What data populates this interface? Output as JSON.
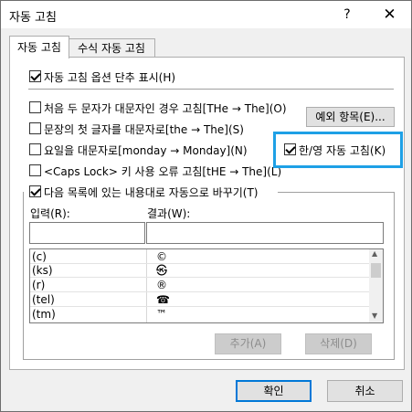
{
  "window": {
    "title": "자동 고침",
    "help": "?",
    "close": "✕"
  },
  "tabs": [
    {
      "label": "자동 고침"
    },
    {
      "label": "수식 자동 고침"
    }
  ],
  "options": {
    "show_button": "자동 고침 옵션 단추 표시(H)",
    "two_caps": "처음 두 문자가 대문자인 경우 고침[THe → The](O)",
    "first_letter": "문장의 첫 글자를 대문자로[the → The](S)",
    "days": "요일을 대문자로[monday → Monday](N)",
    "caps_lock": "<Caps Lock> 키 사용 오류 고침[tHE → The](L)",
    "hangul_eng": "한/영 자동 고침(K)",
    "replace_as_type": "다음 목록에 있는 내용대로 자동으로 바꾸기(T)"
  },
  "exceptions_button": "예외 항목(E)...",
  "replace_label": "입력(R):",
  "with_label": "결과(W):",
  "replace_value": "",
  "with_value": "",
  "entries": [
    {
      "input": "(c)",
      "result": "©"
    },
    {
      "input": "(ks)",
      "result": "㉿"
    },
    {
      "input": "(r)",
      "result": "®"
    },
    {
      "input": "(tel)",
      "result": "☎"
    },
    {
      "input": "(tm)",
      "result": "™"
    }
  ],
  "add_button": "추가(A)",
  "delete_button": "삭제(D)",
  "ok_button": "확인",
  "cancel_button": "취소",
  "scroll_up": "▲",
  "scroll_down": "▼"
}
